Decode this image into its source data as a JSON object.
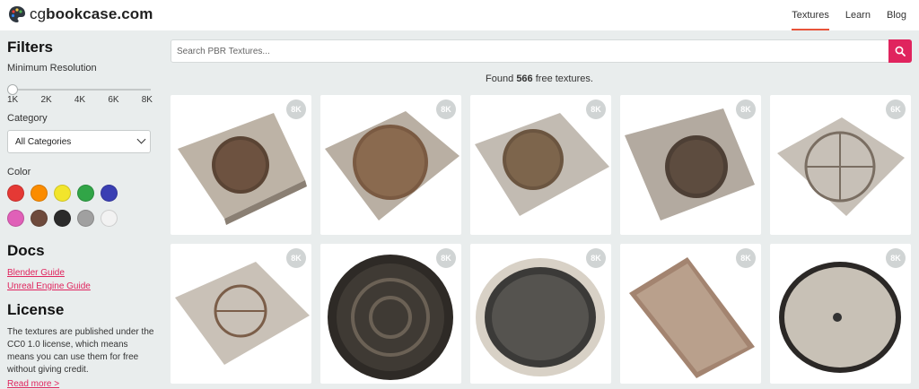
{
  "header": {
    "logo_prefix": "cg",
    "logo_main": "bookcase.com",
    "nav": [
      {
        "label": "Textures",
        "active": true
      },
      {
        "label": "Learn",
        "active": false
      },
      {
        "label": "Blog",
        "active": false
      }
    ]
  },
  "sidebar": {
    "filters_title": "Filters",
    "min_res_label": "Minimum Resolution",
    "resolution_ticks": [
      "1K",
      "2K",
      "4K",
      "6K",
      "8K"
    ],
    "resolution_selected": "1K",
    "category_label": "Category",
    "category_value": "All Categories",
    "color_label": "Color",
    "colors": [
      "#e53935",
      "#fb8c00",
      "#f2e52c",
      "#31a547",
      "#3a3fb3",
      "#e060b8",
      "#6e4a3c",
      "#2b2b2b",
      "#a0a0a0",
      "#f2f2f2"
    ],
    "docs_title": "Docs",
    "docs_links": [
      "Blender Guide",
      "Unreal Engine Guide"
    ],
    "license_title": "License",
    "license_text": "The textures are published under the CC0 1.0 license, which means means you can use them for free without giving credit.",
    "read_more": "Read more >"
  },
  "main": {
    "search_placeholder": "Search PBR Textures...",
    "found_prefix": "Found",
    "found_count": "566",
    "found_suffix": "free textures.",
    "cards": [
      {
        "badge": "8K",
        "style": "square-tile"
      },
      {
        "badge": "8K",
        "style": "square-tile"
      },
      {
        "badge": "8K",
        "style": "square-tile"
      },
      {
        "badge": "8K",
        "style": "square-tile"
      },
      {
        "badge": "6K",
        "style": "square-tile"
      },
      {
        "badge": "8K",
        "style": "square-tile"
      },
      {
        "badge": "8K",
        "style": "round-cover"
      },
      {
        "badge": "8K",
        "style": "round-cover"
      },
      {
        "badge": "8K",
        "style": "rect-plate"
      },
      {
        "badge": "8K",
        "style": "round-cover"
      }
    ]
  }
}
